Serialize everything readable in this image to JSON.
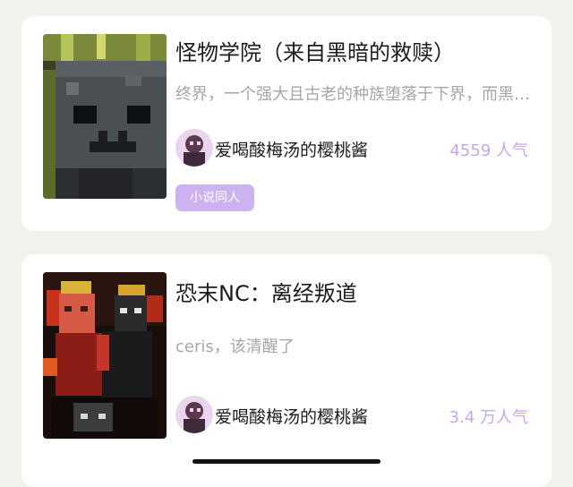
{
  "cards": [
    {
      "title": "怪物学院（来自黑暗的救赎）",
      "description": "终界，一个强大且古老的种族堕落于下界，而黑曜石之主……",
      "author": "爱喝酸梅汤的樱桃酱",
      "popularity": "4559 人气",
      "tag": "小说同人"
    },
    {
      "title": "恐末NC：离经叛道",
      "description": "ceris，该清醒了",
      "author": "爱喝酸梅汤的樱桃酱",
      "popularity": "3.4 万人气"
    }
  ],
  "colors": {
    "background": "#f3f1ee",
    "card": "#ffffff",
    "accent": "#c8a6ec",
    "tag_bg": "#ccb2f0"
  }
}
